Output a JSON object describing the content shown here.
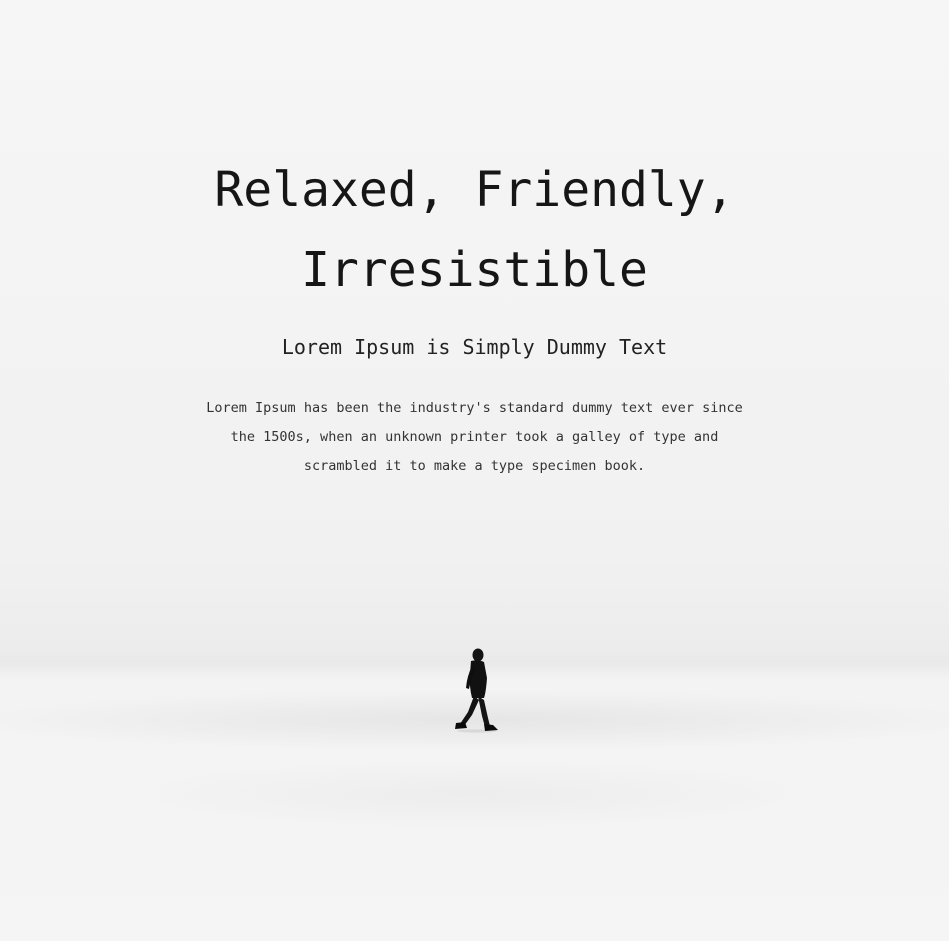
{
  "hero": {
    "title": "Relaxed, Friendly, Irresistible",
    "subtitle": "Lorem Ipsum is Simply Dummy Text",
    "body": "Lorem Ipsum has been the industry's standard dummy text ever since the 1500s, when an unknown printer took a galley of type and scrambled it to make a type specimen book."
  },
  "colors": {
    "background": "#f4f4f4",
    "text": "#161616"
  }
}
